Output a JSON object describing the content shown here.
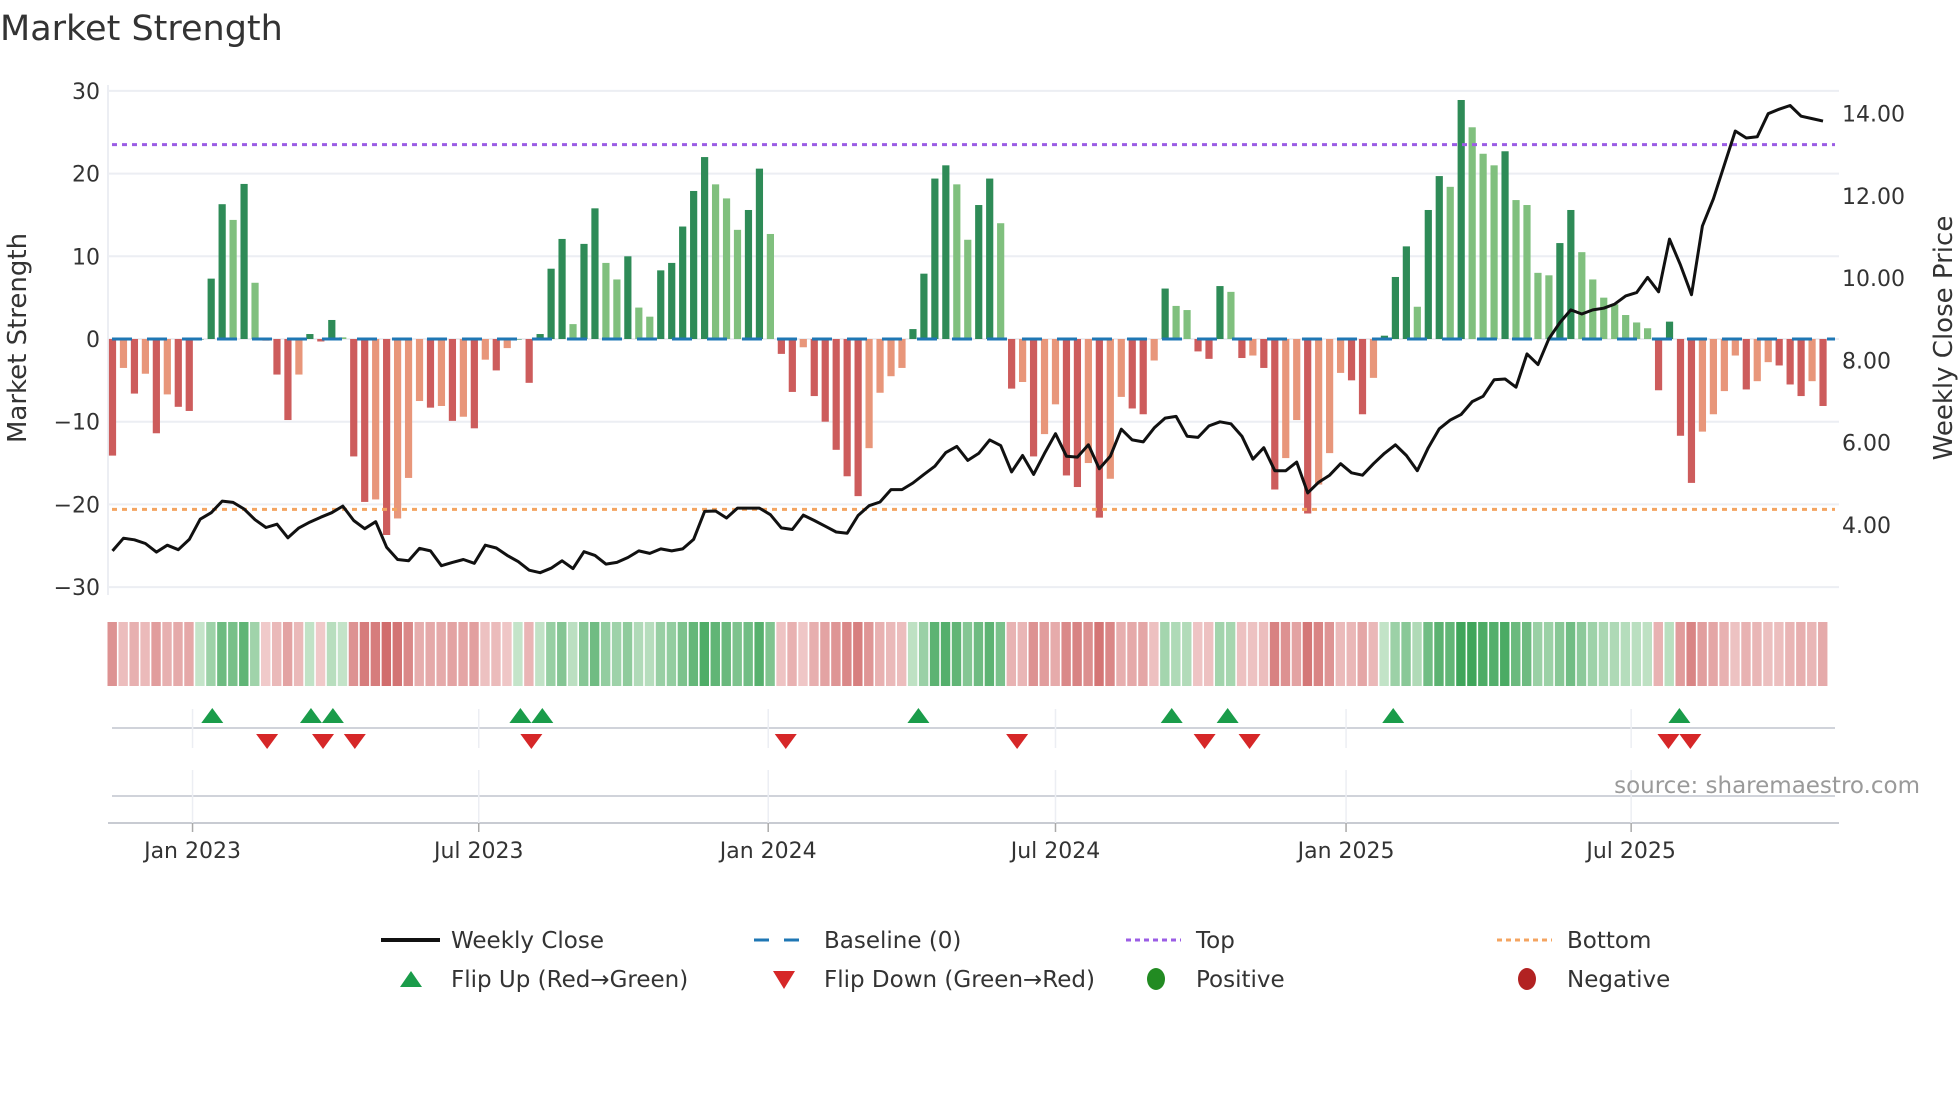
{
  "chart_data": {
    "type": "bar",
    "title": "Market Strength",
    "ylabel": "Market Strength",
    "y2label": "Weekly Close Price",
    "ylim": [
      -31,
      31
    ],
    "y2lim": [
      2.3,
      14.6
    ],
    "yticks": [
      30,
      20,
      10,
      0,
      -10,
      -20,
      -30
    ],
    "yticklabels": [
      "30",
      "20",
      "10",
      "0",
      "−10",
      "−20",
      "−30"
    ],
    "y2ticks": [
      14,
      12,
      10,
      8,
      6,
      4
    ],
    "y2ticklabels": [
      "14.00",
      "12.00",
      "10.00",
      "8.00",
      "6.00",
      "4.00"
    ],
    "xticks": [
      {
        "week": 7.3,
        "label": "Jan 2023"
      },
      {
        "week": 33.4,
        "label": "Jul 2023"
      },
      {
        "week": 59.8,
        "label": "Jan 2024"
      },
      {
        "week": 86.0,
        "label": "Jul 2024"
      },
      {
        "week": 112.5,
        "label": "Jan 2025"
      },
      {
        "week": 138.5,
        "label": "Jul 2025"
      }
    ],
    "grid": true,
    "top_level": 23.5,
    "bottom_level": -20.6,
    "baseline": 0,
    "strength": [
      -14.1,
      -3.5,
      -6.6,
      -4.2,
      -11.4,
      -6.7,
      -8.2,
      -8.7,
      0,
      7.3,
      16.3,
      14.4,
      18.75,
      6.8,
      -0.2,
      -4.3,
      -9.8,
      -4.3,
      0.6,
      -0.3,
      2.3,
      0.2,
      -14.2,
      -19.7,
      -19.4,
      -23.7,
      -21.7,
      -16.8,
      -7.5,
      -8.3,
      -8.1,
      -9.9,
      -9.4,
      -10.8,
      -2.5,
      -3.8,
      -1.1,
      0,
      -5.3,
      0.6,
      8.5,
      12.1,
      1.8,
      11.5,
      15.8,
      9.2,
      7.2,
      10.0,
      3.8,
      2.7,
      8.3,
      9.2,
      13.6,
      17.9,
      22.0,
      18.7,
      17.0,
      13.2,
      15.6,
      20.6,
      12.7,
      -1.8,
      -6.4,
      -1.0,
      -6.9,
      -10.0,
      -13.4,
      -16.6,
      -19.0,
      -13.2,
      -6.5,
      -4.5,
      -3.5,
      1.2,
      7.9,
      19.4,
      21.0,
      18.7,
      12.0,
      16.2,
      19.4,
      14.0,
      -6.0,
      -5.2,
      -14.2,
      -11.5,
      -7.9,
      -16.5,
      -17.9,
      -15.0,
      -21.6,
      -16.9,
      -7.0,
      -8.4,
      -9.1,
      -2.6,
      6.1,
      4.0,
      3.5,
      -1.5,
      -2.4,
      6.4,
      5.7,
      -2.3,
      -2.0,
      -3.5,
      -18.2,
      -14.4,
      -9.8,
      -21.1,
      -17.6,
      -13.8,
      -4.1,
      -5.0,
      -9.1,
      -4.7,
      0.4,
      7.5,
      11.2,
      3.9,
      15.6,
      19.7,
      18.4,
      28.9,
      25.6,
      22.4,
      21.0,
      22.7,
      16.8,
      16.2,
      8.0,
      7.7,
      11.6,
      15.6,
      10.5,
      7.2,
      5.0,
      4.2,
      2.9,
      2.0,
      1.3,
      -6.2,
      2.1,
      -11.7,
      -17.4,
      -11.2,
      -9.1,
      -6.3,
      -2.0,
      -6.1,
      -5.1,
      -2.8,
      -3.2,
      -5.5,
      -6.9,
      -5.1,
      -8.1
    ],
    "weekly_close": [
      3.37,
      3.68,
      3.64,
      3.55,
      3.34,
      3.51,
      3.4,
      3.65,
      4.14,
      4.3,
      4.58,
      4.55,
      4.39,
      4.13,
      3.94,
      4.02,
      3.69,
      3.93,
      4.07,
      4.19,
      4.3,
      4.46,
      4.11,
      3.91,
      4.08,
      3.46,
      3.16,
      3.13,
      3.43,
      3.37,
      3.01,
      3.09,
      3.16,
      3.07,
      3.51,
      3.44,
      3.26,
      3.11,
      2.9,
      2.84,
      2.95,
      3.13,
      2.94,
      3.35,
      3.26,
      3.05,
      3.09,
      3.21,
      3.37,
      3.31,
      3.42,
      3.37,
      3.42,
      3.65,
      4.33,
      4.34,
      4.17,
      4.41,
      4.41,
      4.41,
      4.25,
      3.93,
      3.89,
      4.24,
      4.11,
      3.97,
      3.83,
      3.8,
      4.23,
      4.47,
      4.56,
      4.86,
      4.86,
      5.02,
      5.23,
      5.43,
      5.76,
      5.91,
      5.57,
      5.74,
      6.07,
      5.93,
      5.29,
      5.69,
      5.23,
      5.74,
      6.22,
      5.67,
      5.65,
      5.95,
      5.37,
      5.67,
      6.33,
      6.07,
      6.02,
      6.36,
      6.6,
      6.64,
      6.16,
      6.13,
      6.41,
      6.51,
      6.46,
      6.16,
      5.6,
      5.88,
      5.32,
      5.32,
      5.53,
      4.78,
      5.04,
      5.21,
      5.49,
      5.27,
      5.21,
      5.49,
      5.74,
      5.95,
      5.69,
      5.32,
      5.88,
      6.34,
      6.55,
      6.69,
      7.0,
      7.13,
      7.53,
      7.55,
      7.35,
      8.16,
      7.9,
      8.53,
      8.92,
      9.23,
      9.13,
      9.23,
      9.27,
      9.37,
      9.57,
      9.65,
      10.02,
      9.67,
      10.95,
      10.32,
      9.6,
      11.27,
      11.93,
      12.76,
      13.58,
      13.41,
      13.44,
      14.0,
      14.11,
      14.2,
      13.94,
      13.88,
      13.82
    ],
    "flip_up_weeks": [
      9.1,
      18.1,
      20.1,
      37.2,
      39.2,
      73.5,
      96.6,
      101.7,
      116.8,
      142.9
    ],
    "flip_down_weeks": [
      14.1,
      19.2,
      22.1,
      38.2,
      61.4,
      82.5,
      99.6,
      103.7,
      141.9,
      143.9
    ],
    "colors": {
      "strong_green": "#2e8b57",
      "fading_green": "#80c07e",
      "strong_red": "#cd5c5c",
      "fading_red": "#e8967a",
      "line": "#111111",
      "baseline": "#1f77b4",
      "top": "#9b5de5",
      "bottom": "#f4a460",
      "flip_up": "#1a9c4a",
      "flip_down": "#d62728",
      "positive": "#228b22",
      "negative": "#b22222"
    },
    "legend": {
      "placement": "bottom",
      "items": [
        {
          "key": "weekly_close",
          "label": "Weekly Close"
        },
        {
          "key": "baseline",
          "label": "Baseline (0)"
        },
        {
          "key": "top",
          "label": "Top"
        },
        {
          "key": "bottom",
          "label": "Bottom"
        },
        {
          "key": "flip_up",
          "label": "Flip Up (Red→Green)"
        },
        {
          "key": "flip_down",
          "label": "Flip Down (Green→Red)"
        },
        {
          "key": "positive",
          "label": "Positive"
        },
        {
          "key": "negative",
          "label": "Negative"
        }
      ]
    },
    "source": "source: sharemaestro.com"
  }
}
